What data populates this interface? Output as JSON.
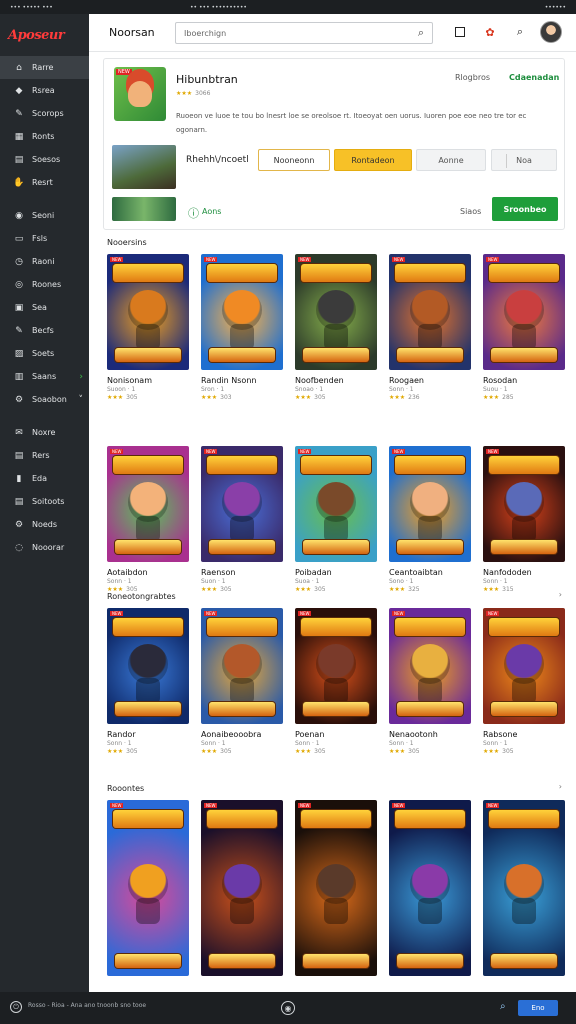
{
  "topbar": {
    "left": "••• ••••• •••",
    "mid": "•• ••• ••••••••••",
    "right": "••••••"
  },
  "app": {
    "logo_text": "Aposeur"
  },
  "sidebar": {
    "items": [
      {
        "label": "Rarre",
        "icon": "home-icon",
        "glyph": "⌂",
        "active": true
      },
      {
        "label": "Rsrea",
        "icon": "tag-icon",
        "glyph": "◆"
      },
      {
        "label": "Scorops",
        "icon": "pen-icon",
        "glyph": "✎"
      },
      {
        "label": "Ronts",
        "icon": "grid-icon",
        "glyph": "▦"
      },
      {
        "label": "Soesos",
        "icon": "document-icon",
        "glyph": "▤"
      },
      {
        "label": "Resrt",
        "icon": "hand-icon",
        "glyph": "✋"
      },
      {
        "label": "Seoni",
        "icon": "circle-icon",
        "glyph": "◉",
        "gap_before": true
      },
      {
        "label": "Fsls",
        "icon": "folder-icon",
        "glyph": "▭"
      },
      {
        "label": "Raoni",
        "icon": "clock-icon",
        "glyph": "◷"
      },
      {
        "label": "Roones",
        "icon": "target-icon",
        "glyph": "◎"
      },
      {
        "label": "Sea",
        "icon": "lock-icon",
        "glyph": "▣"
      },
      {
        "label": "Becfs",
        "icon": "wand-icon",
        "glyph": "✎"
      },
      {
        "label": "Soets",
        "icon": "layers-icon",
        "glyph": "▨"
      },
      {
        "label": "Saans",
        "icon": "chart-icon",
        "glyph": "▥",
        "chevron": "›",
        "chevron_color": "green"
      },
      {
        "label": "Soaobon",
        "icon": "settings-icon",
        "glyph": "⚙",
        "chevron": "˅"
      },
      {
        "label": "Noxre",
        "icon": "mail-icon",
        "glyph": "✉",
        "gap_before": true
      },
      {
        "label": "Rers",
        "icon": "inbox-icon",
        "glyph": "▤"
      },
      {
        "label": "Eda",
        "icon": "bookmark-icon",
        "glyph": "▮"
      },
      {
        "label": "Soitoots",
        "icon": "clipboard-icon",
        "glyph": "▤"
      },
      {
        "label": "Noeds",
        "icon": "gear-icon",
        "glyph": "⚙"
      },
      {
        "label": "Nooorar",
        "icon": "globe-icon",
        "glyph": "◌"
      }
    ]
  },
  "header": {
    "title": "Noorsan",
    "search_placeholder": "Iboerchign",
    "icons": [
      "square-icon",
      "badge-icon",
      "search-icon"
    ]
  },
  "feature": {
    "badge": "NEW",
    "title": "Hibunbtran",
    "rating_stars": "★★★",
    "rating_text": "3066",
    "link1": "Rlogbros",
    "link2": "Cdaenadan",
    "description": "Ruoeon ve luoe te tou bo lnesrt loe se oreolsoe rt. Itoeoyat oen uorus. Iuoren poe eoe neo tre tor ec ogonarn.",
    "sub_title": "Rhehh\\/ncoetl",
    "buttons": [
      "Nooneonn",
      "Rontadeon",
      "Aonne",
      "Noa"
    ],
    "cta_icon": "info-icon",
    "cta_label": "Aons",
    "link3": "Siaos",
    "green_button": "Sroonbeo"
  },
  "sections": [
    {
      "title": "Nooersins",
      "more": "",
      "games": [
        {
          "name": "Nonisonam",
          "meta": "Suoon · 1",
          "stars": "★★★",
          "count": "305",
          "c1": "#1b2a7a",
          "c2": "#f0a020",
          "c3": "#d97a1e"
        },
        {
          "name": "Randin Nsonn",
          "meta": "Sron · 1",
          "stars": "★★★",
          "count": "303",
          "c1": "#1f6fd0",
          "c2": "#ffb347",
          "c3": "#f08a24"
        },
        {
          "name": "Noofbenden",
          "meta": "Snoao · 1",
          "stars": "★★★",
          "count": "305",
          "c1": "#2c3a2a",
          "c2": "#87b04c",
          "c3": "#3b3b3b"
        },
        {
          "name": "Roogaen",
          "meta": "Sonn · 1",
          "stars": "★★★",
          "count": "236",
          "c1": "#23336b",
          "c2": "#e8742a",
          "c3": "#b35a25"
        },
        {
          "name": "Rosodan",
          "meta": "Suou · 1",
          "stars": "★★★",
          "count": "285",
          "c1": "#5a2a8a",
          "c2": "#f27c3c",
          "c3": "#c93f3f"
        }
      ]
    },
    {
      "title": "",
      "more": "",
      "games": [
        {
          "name": "Aotaibdon",
          "meta": "Sonn · 1",
          "stars": "★★★",
          "count": "305",
          "c1": "#a9308f",
          "c2": "#5ac35a",
          "c3": "#f3b27a"
        },
        {
          "name": "Raenson",
          "meta": "Suon · 1",
          "stars": "★★★",
          "count": "305",
          "c1": "#3a2a6a",
          "c2": "#4a6fd8",
          "c3": "#8a3fa8"
        },
        {
          "name": "Poibadan",
          "meta": "Suoa · 1",
          "stars": "★★★",
          "count": "305",
          "c1": "#3aa0c8",
          "c2": "#6abf4a",
          "c3": "#7a4a2a"
        },
        {
          "name": "Ceantoaibtan",
          "meta": "Sono · 1",
          "stars": "★★★",
          "count": "325",
          "c1": "#1f6fd0",
          "c2": "#f5a020",
          "c3": "#f0b080"
        },
        {
          "name": "Nanfododen",
          "meta": "Sonn · 1",
          "stars": "★★★",
          "count": "315",
          "c1": "#2a1010",
          "c2": "#d8421a",
          "c3": "#5a6ab8"
        }
      ]
    },
    {
      "title": "Roneotongrabtes",
      "more": "›",
      "games": [
        {
          "name": "Randor",
          "meta": "Sonn · 1",
          "stars": "★★★",
          "count": "305",
          "c1": "#0f2a6a",
          "c2": "#3a7ad8",
          "c3": "#2a2a3a"
        },
        {
          "name": "Aonaibeooobra",
          "meta": "Sonn · 1",
          "stars": "★★★",
          "count": "305",
          "c1": "#2a5aa8",
          "c2": "#e8a83a",
          "c3": "#b3582a"
        },
        {
          "name": "Poenan",
          "meta": "Sonn · 1",
          "stars": "★★★",
          "count": "305",
          "c1": "#2a0f0a",
          "c2": "#d8501a",
          "c3": "#7a3a2a"
        },
        {
          "name": "Nenaootonh",
          "meta": "Sonn · 1",
          "stars": "★★★",
          "count": "305",
          "c1": "#6a2a9a",
          "c2": "#f0a020",
          "c3": "#e8b040"
        },
        {
          "name": "Rabsone",
          "meta": "Sonn · 1",
          "stars": "★★★",
          "count": "305",
          "c1": "#8a2a1a",
          "c2": "#f08a1a",
          "c3": "#6a3aa8"
        }
      ]
    },
    {
      "title": "Rooontes",
      "more": "›",
      "games": [
        {
          "name": "",
          "meta": "",
          "stars": "",
          "count": "",
          "c1": "#2a6ad8",
          "c2": "#d84a9a",
          "c3": "#f0a020"
        },
        {
          "name": "",
          "meta": "",
          "stars": "",
          "count": "",
          "c1": "#1a0f2a",
          "c2": "#c8501a",
          "c3": "#6a3aa8"
        },
        {
          "name": "",
          "meta": "",
          "stars": "",
          "count": "",
          "c1": "#1a0f0a",
          "c2": "#d86a1a",
          "c3": "#5a3a2a"
        },
        {
          "name": "",
          "meta": "",
          "stars": "",
          "count": "",
          "c1": "#0f1a4a",
          "c2": "#3a9ad8",
          "c3": "#8a3aa8"
        },
        {
          "name": "",
          "meta": "",
          "stars": "",
          "count": "",
          "c1": "#0f2a5a",
          "c2": "#3aa0d8",
          "c3": "#d8702a"
        }
      ]
    }
  ],
  "bottombar": {
    "text": "Rosso - Rioa - Ana ano tnoonb sno tooe",
    "button": "Eno"
  },
  "colors": {
    "accent_green": "#1e9e3a",
    "accent_yellow": "#f7c127",
    "sidebar_bg": "#25292d",
    "logo_red": "#ff3b3b"
  }
}
